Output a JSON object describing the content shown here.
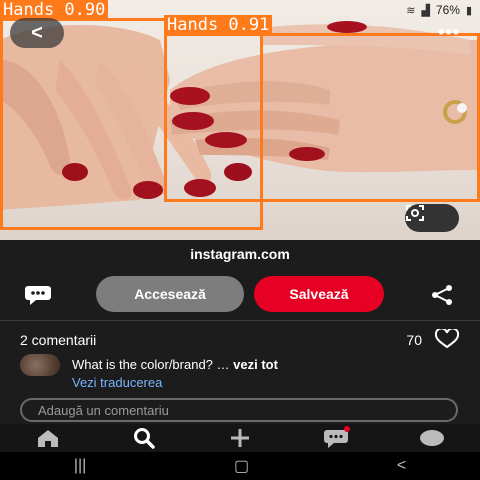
{
  "status_bar": {
    "battery": "76%"
  },
  "detections": [
    {
      "label": "Hands 0.90"
    },
    {
      "label": "Hands 0.91"
    }
  ],
  "photo": {
    "back_glyph": "<",
    "more_glyph": "•••"
  },
  "pin": {
    "source": "instagram.com",
    "visit_label": "Accesează",
    "save_label": "Salvează"
  },
  "comments": {
    "count_label": "2 comentarii",
    "likes": "70",
    "items": [
      {
        "text": "What is the color/brand? …",
        "more": "vezi tot",
        "translate": "Vezi traducerea"
      }
    ],
    "input_placeholder": "Adaugă un comentariu"
  },
  "icons": {
    "back": "chevron-left-icon",
    "more": "more-options-icon",
    "lens": "visual-search-icon",
    "comment": "comment-bubble-icon",
    "share": "share-icon",
    "heart": "heart-icon",
    "home": "home-icon",
    "search": "search-icon",
    "create": "plus-icon",
    "messages": "chat-icon",
    "profile": "profile-avatar-icon"
  },
  "colors": {
    "save_button": "#e60023",
    "visit_button": "#7d7d7d",
    "detection_box": "#ff7a1a",
    "link": "#79b4ff"
  }
}
